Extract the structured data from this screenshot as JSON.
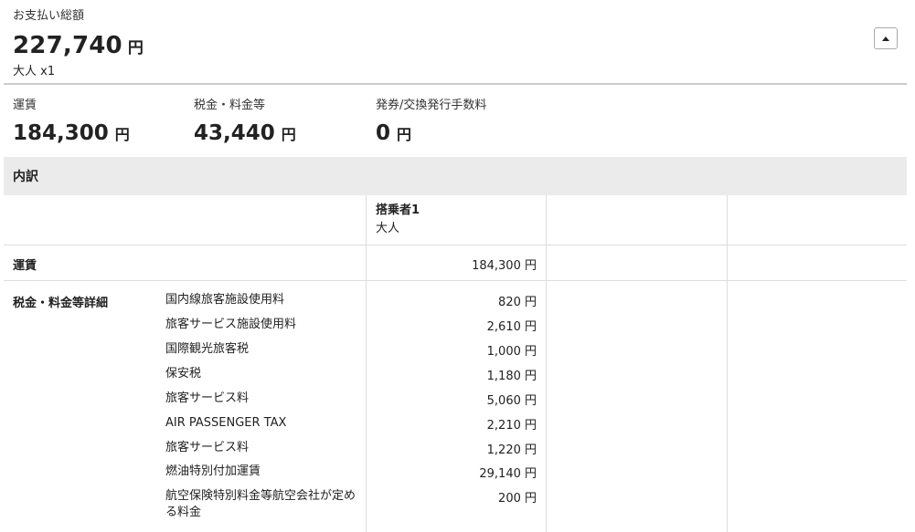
{
  "total": {
    "label": "お支払い総額",
    "amount": "227,740",
    "currency": "円",
    "passengers": "大人 x1"
  },
  "collapse_button": {
    "icon": "caret-up-icon"
  },
  "summary": [
    {
      "label": "運賃",
      "amount": "184,300",
      "currency": "円"
    },
    {
      "label": "税金・料金等",
      "amount": "43,440",
      "currency": "円"
    },
    {
      "label": "発券/交換発行手数料",
      "amount": "0",
      "currency": "円"
    }
  ],
  "breakdown": {
    "title": "内訳",
    "passenger": {
      "name": "搭乗者1",
      "type": "大人"
    },
    "fare": {
      "label": "運賃",
      "amount": "184,300 円"
    },
    "taxes": {
      "label": "税金・料金等詳細",
      "items": [
        {
          "name": "国内線旅客施設使用料",
          "amount": "820 円"
        },
        {
          "name": "旅客サービス施設使用料",
          "amount": "2,610 円"
        },
        {
          "name": "国際観光旅客税",
          "amount": "1,000 円"
        },
        {
          "name": "保安税",
          "amount": "1,180 円"
        },
        {
          "name": "旅客サービス料",
          "amount": "5,060 円"
        },
        {
          "name": "AIR PASSENGER TAX",
          "amount": "2,210 円"
        },
        {
          "name": "旅客サービス料",
          "amount": "1,220 円"
        },
        {
          "name": "燃油特別付加運賃",
          "amount": "29,140 円"
        },
        {
          "name": "航空保険特別料金等航空会社が定める料金",
          "amount": "200 円"
        }
      ]
    }
  }
}
